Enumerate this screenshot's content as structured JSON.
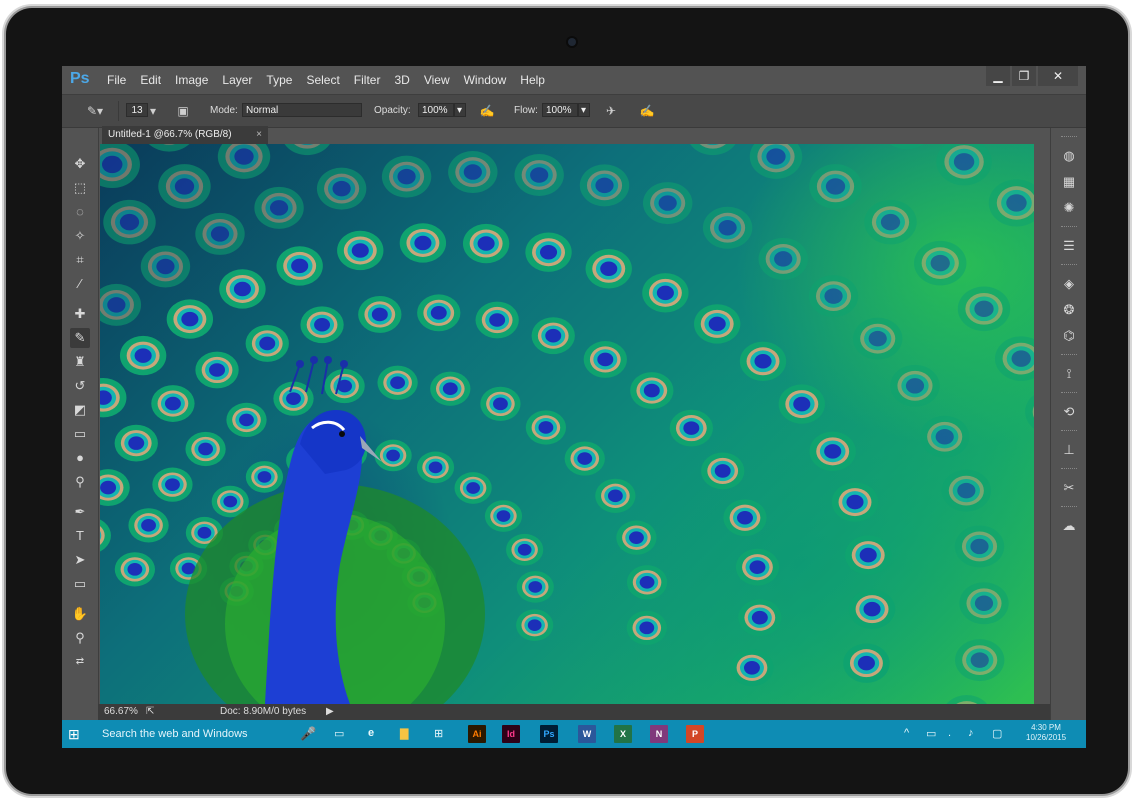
{
  "app": {
    "logo": "Ps"
  },
  "menu": [
    "File",
    "Edit",
    "Image",
    "Layer",
    "Type",
    "Select",
    "Filter",
    "3D",
    "View",
    "Window",
    "Help"
  ],
  "window_controls": {
    "minimize": "▁",
    "restore": "❐",
    "close": "✕"
  },
  "options": {
    "brush_size": "13",
    "mode_label": "Mode:",
    "mode_value": "Normal",
    "opacity_label": "Opacity:",
    "opacity_value": "100%",
    "flow_label": "Flow:",
    "flow_value": "100%"
  },
  "document": {
    "tab_title": "Untitled-1 @66.7% (RGB/8)",
    "tab_close": "×"
  },
  "status": {
    "zoom": "66.67%",
    "doc_info": "Doc: 8.90M/0 bytes"
  },
  "tools": [
    "move-tool",
    "marquee-tool",
    "lasso-tool",
    "quick-selection-tool",
    "crop-tool",
    "eyedropper-tool",
    "spot-healing-tool",
    "brush-tool",
    "clone-stamp-tool",
    "history-brush-tool",
    "eraser-tool",
    "gradient-tool",
    "blur-tool",
    "dodge-tool",
    "pen-tool",
    "type-tool",
    "path-selection-tool",
    "rectangle-tool",
    "hand-tool",
    "zoom-tool"
  ],
  "colors": {
    "foreground": "#12c41b",
    "background": "#1835d8",
    "taskbar": "#0e8cb4",
    "ps_blue": "#4ca8e8"
  },
  "taskbar": {
    "search_placeholder": "Search the web and Windows",
    "apps": [
      {
        "name": "Ai",
        "color": "#ff7c00",
        "bg": "#2b1800"
      },
      {
        "name": "Id",
        "color": "#ff3a8c",
        "bg": "#2e0218"
      },
      {
        "name": "Ps",
        "color": "#31a8ff",
        "bg": "#001d34"
      },
      {
        "name": "W",
        "color": "#ffffff",
        "bg": "#2b579a"
      },
      {
        "name": "X",
        "color": "#ffffff",
        "bg": "#217346"
      },
      {
        "name": "N",
        "color": "#ffffff",
        "bg": "#80397b"
      },
      {
        "name": "P",
        "color": "#ffffff",
        "bg": "#d24726"
      }
    ],
    "time": "4:30 PM",
    "date": "10/26/2015"
  }
}
